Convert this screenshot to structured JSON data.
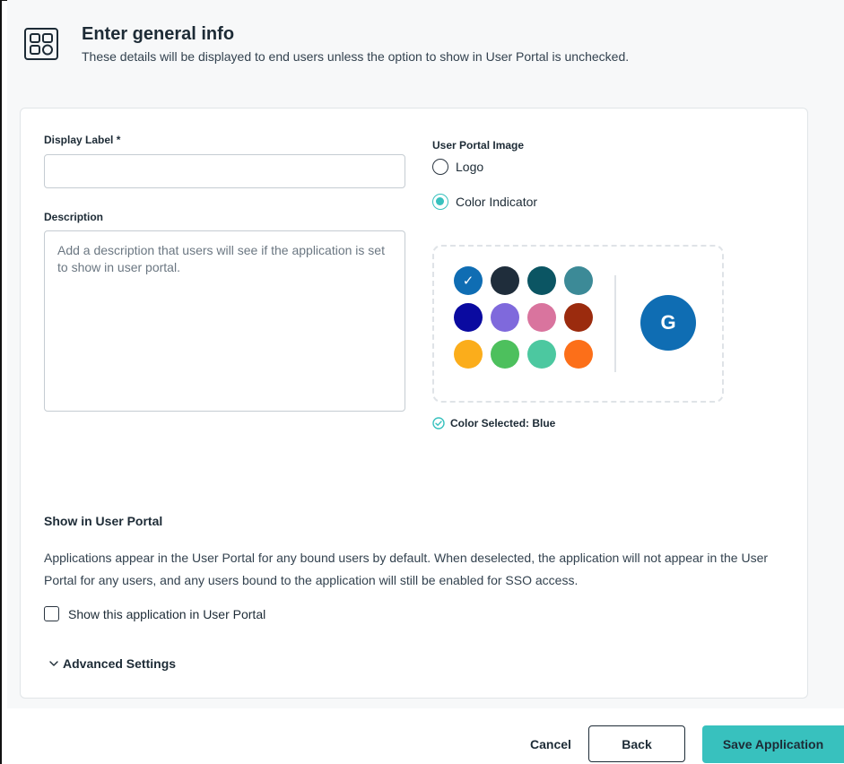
{
  "header": {
    "icon": "apps-grid-icon",
    "title": "Enter general info",
    "subtitle": "These details will be displayed to end users unless the option to show in User Portal is unchecked."
  },
  "form": {
    "display_label": {
      "label": "Display Label *",
      "value": ""
    },
    "description": {
      "label": "Description",
      "value": "",
      "placeholder": "Add a description that users will see if the application is set to show in user portal."
    }
  },
  "portal_image": {
    "label": "User Portal Image",
    "options": [
      {
        "label": "Logo",
        "selected": false
      },
      {
        "label": "Color Indicator",
        "selected": true
      }
    ],
    "swatches": [
      {
        "name": "Blue",
        "color": "#0f6db3",
        "selected": true
      },
      {
        "name": "Navy",
        "color": "#1f2d3b",
        "selected": false
      },
      {
        "name": "Dark Teal",
        "color": "#0b5563",
        "selected": false
      },
      {
        "name": "Teal",
        "color": "#3c8a97",
        "selected": false
      },
      {
        "name": "Indigo",
        "color": "#0a0aa0",
        "selected": false
      },
      {
        "name": "Purple",
        "color": "#7f69dc",
        "selected": false
      },
      {
        "name": "Pink",
        "color": "#d9749e",
        "selected": false
      },
      {
        "name": "Rust",
        "color": "#9b2b0e",
        "selected": false
      },
      {
        "name": "Amber",
        "color": "#fbad1b",
        "selected": false
      },
      {
        "name": "Green",
        "color": "#4dc05d",
        "selected": false
      },
      {
        "name": "Mint",
        "color": "#4cc8a0",
        "selected": false
      },
      {
        "name": "Orange",
        "color": "#fc6f19",
        "selected": false
      }
    ],
    "check_mark": "✓",
    "preview": {
      "letter": "G",
      "color": "#0f6db3"
    },
    "selected_text": "Color Selected: Blue",
    "selected_icon": "check-circle-icon"
  },
  "show_in_portal": {
    "title": "Show in User Portal",
    "body": "Applications appear in the User Portal for any bound users by default. When deselected, the application will not appear in the User Portal for any users, and any users bound to the application will still be enabled for SSO access.",
    "checkbox_label": "Show this application in User Portal",
    "checked": false
  },
  "advanced": {
    "label": "Advanced Settings",
    "icon": "chevron-down-icon"
  },
  "footer": {
    "cancel_label": "Cancel",
    "back_label": "Back",
    "save_label": "Save Application",
    "accent_color": "#38c1be"
  }
}
